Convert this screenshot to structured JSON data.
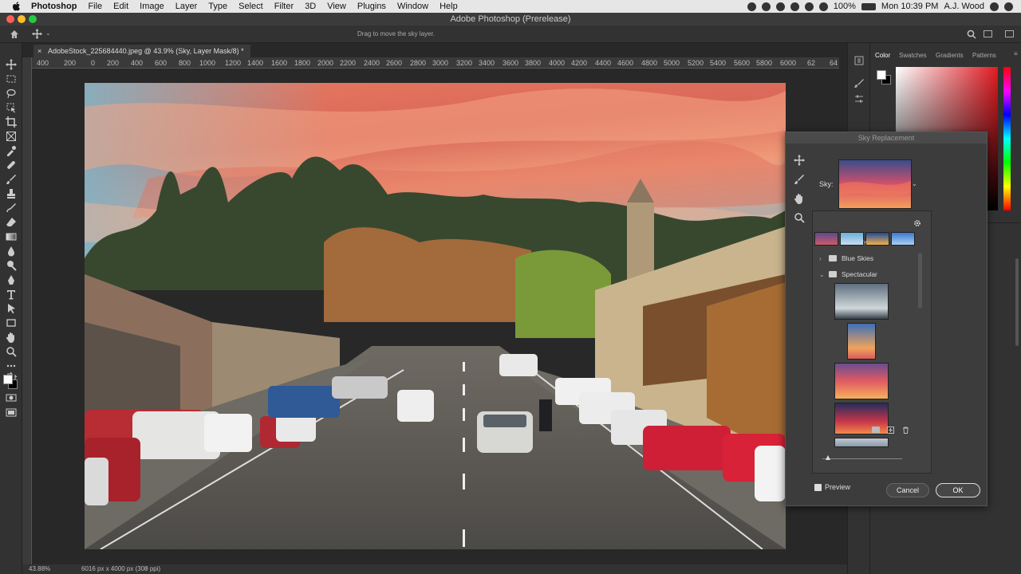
{
  "menubar": {
    "app": "Photoshop",
    "items": [
      "File",
      "Edit",
      "Image",
      "Layer",
      "Type",
      "Select",
      "Filter",
      "3D",
      "View",
      "Plugins",
      "Window",
      "Help"
    ],
    "battery": "100%",
    "clock": "Mon 10:39 PM",
    "user": "A.J. Wood"
  },
  "window": {
    "title": "Adobe Photoshop (Prerelease)"
  },
  "options": {
    "hint": "Drag to move the sky layer."
  },
  "document": {
    "tab_label": "AdobeStock_225684440.jpeg @ 43.9% (Sky, Layer Mask/8) *",
    "close_glyph": "×"
  },
  "ruler": {
    "top_ticks": [
      "400",
      "200",
      "0",
      "200",
      "400",
      "600",
      "800",
      "1000",
      "1200",
      "1400",
      "1600",
      "1800",
      "2000",
      "2200",
      "2400",
      "2600",
      "2800",
      "3000",
      "3200",
      "3400",
      "3600",
      "3800",
      "4000",
      "4200",
      "4400",
      "4600",
      "4800",
      "5000",
      "5200",
      "5400",
      "5600",
      "5800",
      "6000",
      "62",
      "64"
    ]
  },
  "status": {
    "zoom": "43.88%",
    "doc_info": "6016 px x 4000 px (300 ppi)"
  },
  "panels": {
    "tabs": [
      "Color",
      "Swatches",
      "Gradients",
      "Patterns"
    ]
  },
  "sky_dialog": {
    "title": "Sky Replacement",
    "sky_label": "Sky:",
    "folders": [
      {
        "name": "Blue Skies",
        "expanded": false
      },
      {
        "name": "Spectacular",
        "expanded": true
      }
    ],
    "preview_label": "Preview",
    "preview_checked": true,
    "cancel_label": "Cancel",
    "ok_label": "OK"
  },
  "colors": {
    "accent": "#0f64d2",
    "chrome": "#323232",
    "canvas_bg": "#282828"
  }
}
